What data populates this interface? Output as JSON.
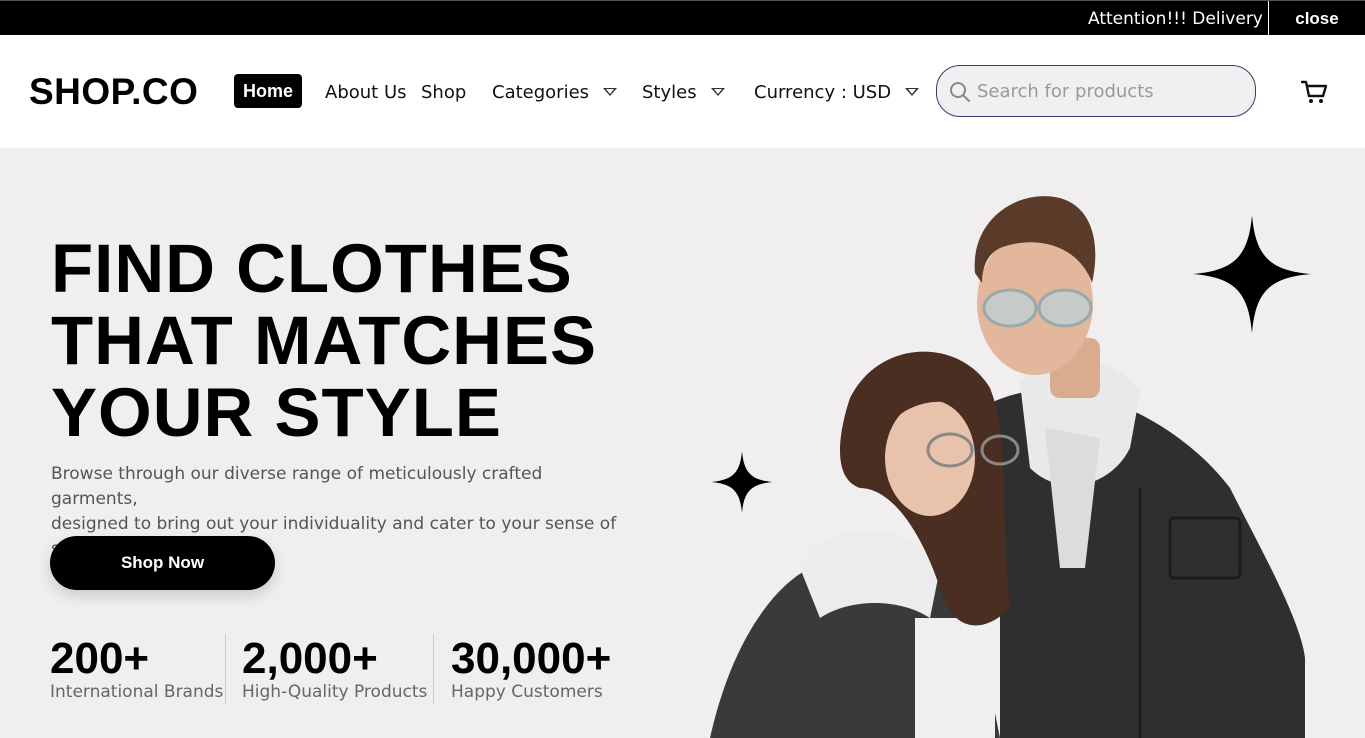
{
  "topbar": {
    "announcement": "Attention!!! Delivery Fee",
    "close_label": "close"
  },
  "header": {
    "logo": "SHOP.CO",
    "nav": {
      "home": "Home",
      "about": "About Us",
      "shop": "Shop",
      "categories": "Categories",
      "styles": "Styles",
      "currency": "Currency : USD"
    },
    "search": {
      "placeholder": "Search for products",
      "value": ""
    },
    "icons": {
      "search": "search-icon",
      "cart": "cart-icon",
      "dropdown": "caret-down-icon"
    }
  },
  "hero": {
    "headline": [
      "FIND CLOTHES",
      "THAT MATCHES",
      "YOUR STYLE"
    ],
    "subtext_lines": [
      "Browse through our diverse range of meticulously crafted garments,",
      "designed to bring out your individuality and cater to your sense of style."
    ],
    "cta_label": "Shop Now",
    "stats": [
      {
        "number": "200+",
        "label": "International Brands"
      },
      {
        "number": "2,000+",
        "label": "High-Quality Products"
      },
      {
        "number": "30,000+",
        "label": "Happy Customers"
      }
    ]
  },
  "colors": {
    "topbar_bg": "#000000",
    "hero_bg": "#f0eeee",
    "accent": "#000000",
    "search_border": "#3b3b6b"
  }
}
